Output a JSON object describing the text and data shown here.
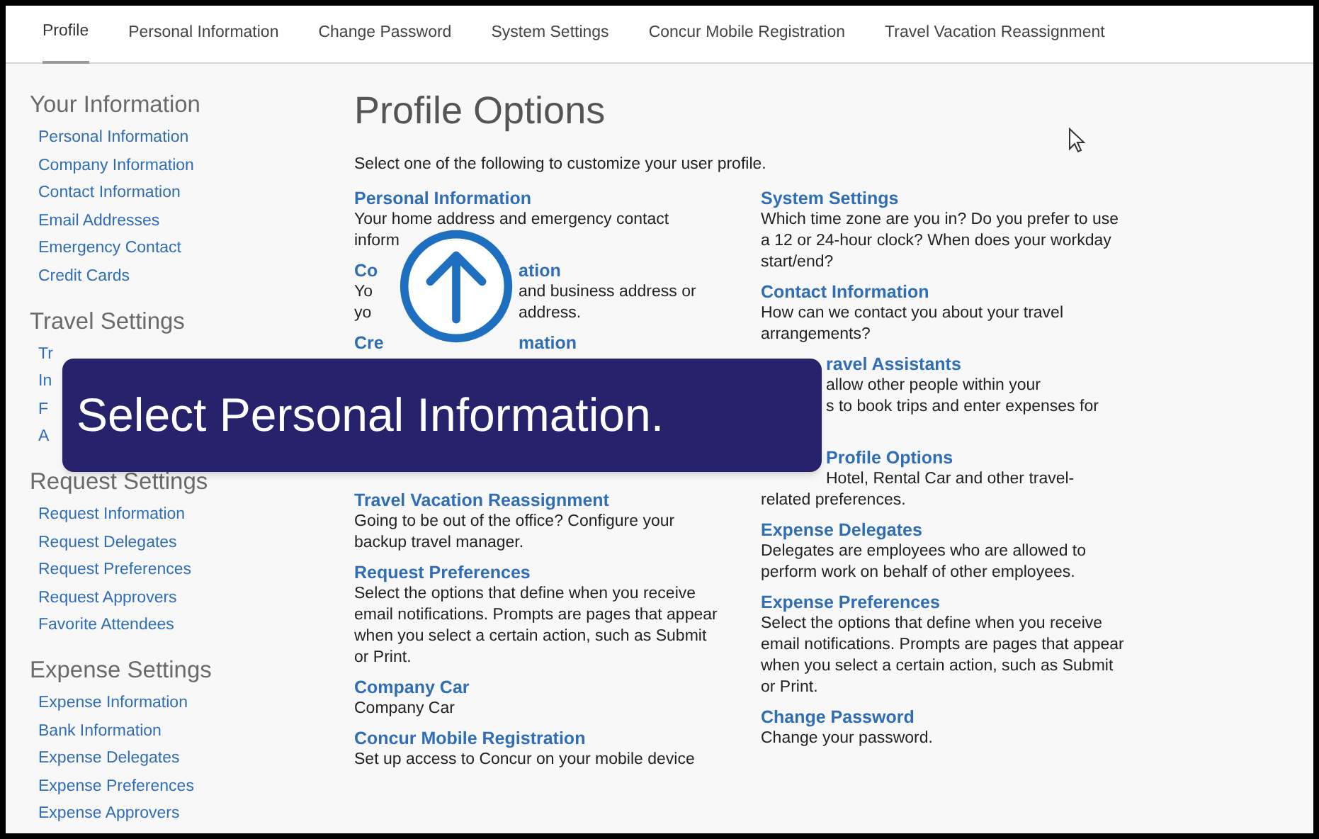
{
  "tabs": [
    {
      "label": "Profile",
      "selected": true
    },
    {
      "label": "Personal Information",
      "selected": false
    },
    {
      "label": "Change Password",
      "selected": false
    },
    {
      "label": "System Settings",
      "selected": false
    },
    {
      "label": "Concur Mobile Registration",
      "selected": false
    },
    {
      "label": "Travel Vacation Reassignment",
      "selected": false
    }
  ],
  "sidebar": {
    "sections": [
      {
        "heading": "Your Information",
        "items": [
          "Personal Information",
          "Company Information",
          "Contact Information",
          "Email Addresses",
          "Emergency Contact",
          "Credit Cards"
        ]
      },
      {
        "heading": "Travel Settings",
        "items": [
          "Tr",
          "In",
          "F",
          "A"
        ]
      },
      {
        "heading": "Request Settings",
        "items": [
          "Request Information",
          "Request Delegates",
          "Request Preferences",
          "Request Approvers",
          "Favorite Attendees"
        ]
      },
      {
        "heading": "Expense Settings",
        "items": [
          "Expense Information",
          "Bank Information",
          "Expense Delegates",
          "Expense Preferences",
          "Expense Approvers"
        ]
      }
    ]
  },
  "main": {
    "title": "Profile Options",
    "intro": "Select one of the following to customize your user profile.",
    "columns": [
      [
        {
          "kind": "partial",
          "lines": [
            {
              "kind": "title",
              "before": "Personal Information"
            },
            {
              "kind": "text",
              "before": "Your home address and emergency contact"
            },
            {
              "kind": "text",
              "before": "inform"
            }
          ]
        },
        {
          "kind": "partial",
          "lines": [
            {
              "kind": "title",
              "before": "Co",
              "after": "ation"
            },
            {
              "kind": "text",
              "before": "Yo",
              "after": "and business address or"
            },
            {
              "kind": "text",
              "before": "yo",
              "after": "address."
            }
          ]
        },
        {
          "kind": "partial",
          "lines": [
            {
              "kind": "title",
              "before": "Cre",
              "after": "mation"
            },
            {
              "kind": "covered"
            },
            {
              "kind": "covered"
            },
            {
              "kind": "covered"
            },
            {
              "kind": "covered"
            },
            {
              "kind": "covered"
            },
            {
              "kind": "covered"
            }
          ]
        },
        {
          "kind": "full",
          "title": "Travel Vacation Reassignment",
          "description": "Going to be out of the office? Configure your backup travel manager."
        },
        {
          "kind": "full",
          "title": "Request Preferences",
          "description": "Select the options that define when you receive email notifications. Prompts are pages that appear when you select a certain action, such as Submit or Print."
        },
        {
          "kind": "full",
          "title": "Company Car",
          "description": "Company Car"
        },
        {
          "kind": "full",
          "title": "Concur Mobile Registration",
          "description": "Set up access to Concur on your mobile device"
        }
      ],
      [
        {
          "kind": "full",
          "title": "System Settings",
          "description": "Which time zone are you in? Do you prefer to use a 12 or 24-hour clock? When does your workday start/end?"
        },
        {
          "kind": "full",
          "title": "Contact Information",
          "description": "How can we contact you about your travel arrangements?"
        },
        {
          "kind": "partial",
          "lines": [
            {
              "kind": "title",
              "after": "ravel Assistants"
            },
            {
              "kind": "text",
              "after": "allow other people within your"
            },
            {
              "kind": "text",
              "after": "s to book trips and enter expenses for"
            },
            {
              "kind": "covered"
            }
          ]
        },
        {
          "kind": "partial",
          "lines": [
            {
              "kind": "title",
              "after": "Profile Options"
            },
            {
              "kind": "text",
              "after": "Hotel, Rental Car and other travel-"
            },
            {
              "kind": "text",
              "before": "related preferences."
            }
          ]
        },
        {
          "kind": "full",
          "title": "Expense Delegates",
          "description": "Delegates are employees who are allowed to perform work on behalf of other employees."
        },
        {
          "kind": "full",
          "title": "Expense Preferences",
          "description": "Select the options that define when you receive email notifications. Prompts are pages that appear when you select a certain action, such as Submit or Print."
        },
        {
          "kind": "full",
          "title": "Change Password",
          "description": "Change your password."
        }
      ]
    ]
  },
  "overlay": {
    "text": "Select Personal Information."
  }
}
